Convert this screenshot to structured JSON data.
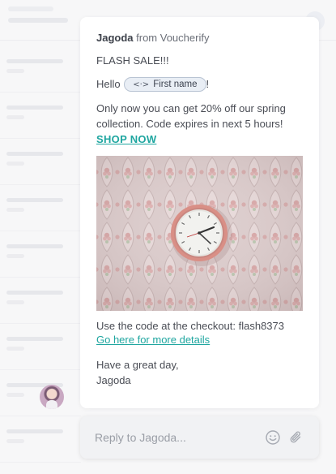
{
  "message": {
    "sender_name": "Jagoda",
    "sender_from": "from Voucherify",
    "headline": "FLASH SALE!!!",
    "greeting_prefix": "Hello",
    "greeting_suffix": "!",
    "variable_icon": "code-brackets-icon",
    "variable_label": "First name",
    "body_line1": "Only now you can get 20% off our spring",
    "body_line2": "collection. Code expires in next 5 hours!",
    "cta": "SHOP NOW",
    "checkout_line": "Use the code at the checkout: flash8373",
    "details_link": "Go here for more details",
    "signoff_line1": "Have a great day,",
    "signoff_line2": "Jagoda"
  },
  "reply": {
    "placeholder": "Reply to Jagoda...",
    "emoji_icon": "smiley-icon",
    "attach_icon": "paperclip-icon"
  },
  "colors": {
    "link": "#1fa6a0",
    "pill_bg": "#e9eef5",
    "pill_border": "#b9c4d3"
  }
}
